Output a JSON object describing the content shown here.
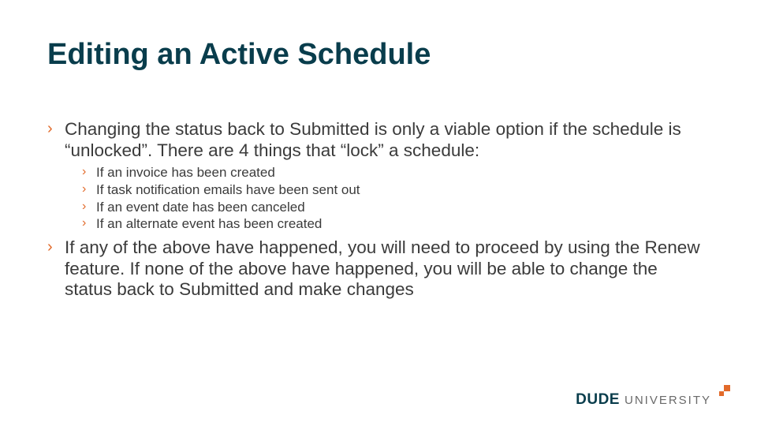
{
  "title": "Editing an Active Schedule",
  "bullets": {
    "b1": "Changing the status back to Submitted is only a viable option if the schedule is “unlocked”. There are 4 things that “lock” a schedule:",
    "sub": [
      "If an invoice has been created",
      "If task notification emails have been sent out",
      "If an event date has been canceled",
      "If an alternate event has been created"
    ],
    "b2": "If any of the above have happened, you will need to proceed by using the Renew feature. If none of the above have happened, you will be able to change the status back to Submitted and make changes"
  },
  "logo": {
    "brand": "DUDE",
    "suffix": "UNIVERSITY"
  }
}
